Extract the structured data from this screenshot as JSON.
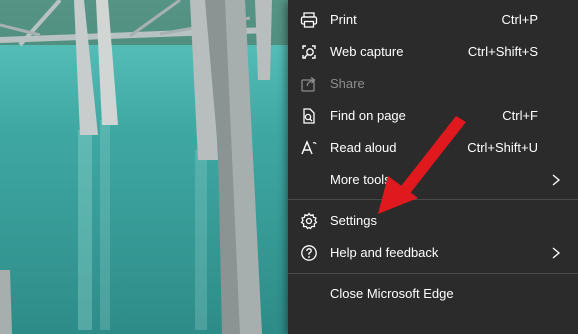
{
  "menu": {
    "items": [
      {
        "label": "Print",
        "shortcut": "Ctrl+P",
        "icon": "print-icon"
      },
      {
        "label": "Web capture",
        "shortcut": "Ctrl+Shift+S",
        "icon": "web-capture-icon"
      },
      {
        "label": "Share",
        "shortcut": "",
        "icon": "share-icon",
        "disabled": true
      },
      {
        "label": "Find on page",
        "shortcut": "Ctrl+F",
        "icon": "find-on-page-icon"
      },
      {
        "label": "Read aloud",
        "shortcut": "Ctrl+Shift+U",
        "icon": "read-aloud-icon"
      },
      {
        "label": "More tools",
        "shortcut": "",
        "icon": "",
        "submenu": true
      },
      {
        "label": "Settings",
        "shortcut": "",
        "icon": "gear-icon"
      },
      {
        "label": "Help and feedback",
        "shortcut": "",
        "icon": "help-icon",
        "submenu": true
      },
      {
        "label": "Close Microsoft Edge",
        "shortcut": "",
        "icon": ""
      }
    ]
  },
  "colors": {
    "menu_background": "#2b2b2b",
    "menu_text": "#ffffff",
    "arrow": "#e0191f"
  }
}
